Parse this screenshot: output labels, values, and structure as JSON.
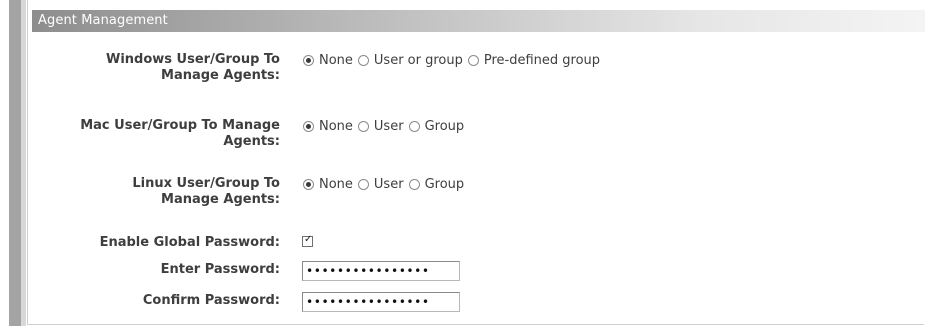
{
  "panel": {
    "title": "Agent Management"
  },
  "windows": {
    "label_line1": "Windows User/Group To",
    "label_line2": "Manage Agents:",
    "options": [
      "None",
      "User or group",
      "Pre-defined group"
    ],
    "selected": "None"
  },
  "mac": {
    "label_line1": "Mac User/Group To Manage",
    "label_line2": "Agents:",
    "options": [
      "None",
      "User",
      "Group"
    ],
    "selected": "None"
  },
  "linux": {
    "label_line1": "Linux User/Group To",
    "label_line2": "Manage Agents:",
    "options": [
      "None",
      "User",
      "Group"
    ],
    "selected": "None"
  },
  "global_password": {
    "enable_label": "Enable Global Password:",
    "enabled": true,
    "enter_label": "Enter Password:",
    "enter_value": "••••••••••••••••",
    "confirm_label": "Confirm Password:",
    "confirm_value": "••••••••••••••••"
  }
}
